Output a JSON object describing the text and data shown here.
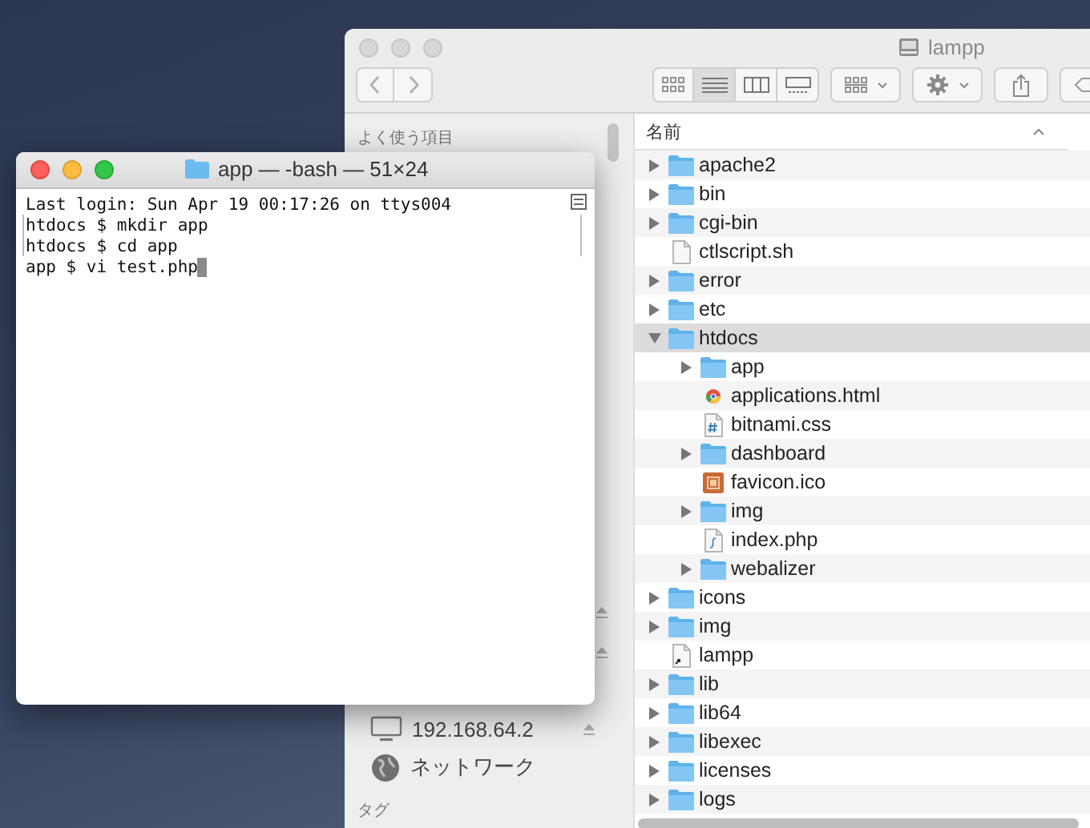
{
  "finder": {
    "title": "lampp",
    "view_buttons": [
      {
        "kind": "icons",
        "selected": false
      },
      {
        "kind": "list",
        "selected": true
      },
      {
        "kind": "columns",
        "selected": false
      },
      {
        "kind": "gallery",
        "selected": false
      }
    ],
    "sidebar": {
      "section": "よく使う項目",
      "items": [
        {
          "kind": "server",
          "label": "192.168.64.2",
          "ejectable": true
        },
        {
          "kind": "network",
          "label": "ネットワーク",
          "ejectable": false
        }
      ],
      "tags_section": "タグ"
    },
    "column_header": "名前",
    "files": [
      {
        "name": "apache2",
        "kind": "folder",
        "expanded": false,
        "selected": false
      },
      {
        "name": "bin",
        "kind": "folder",
        "expanded": false,
        "selected": false
      },
      {
        "name": "cgi-bin",
        "kind": "folder",
        "expanded": false,
        "selected": false
      },
      {
        "name": "ctlscript.sh",
        "kind": "file",
        "selected": false
      },
      {
        "name": "error",
        "kind": "folder",
        "expanded": false,
        "selected": false
      },
      {
        "name": "etc",
        "kind": "folder",
        "expanded": false,
        "selected": false
      },
      {
        "name": "htdocs",
        "kind": "folder",
        "expanded": true,
        "selected": true,
        "children": [
          {
            "name": "app",
            "kind": "folder",
            "expanded": false,
            "selected": false
          },
          {
            "name": "applications.html",
            "kind": "html",
            "selected": false
          },
          {
            "name": "bitnami.css",
            "kind": "css",
            "selected": false
          },
          {
            "name": "dashboard",
            "kind": "folder",
            "expanded": false,
            "selected": false
          },
          {
            "name": "favicon.ico",
            "kind": "image",
            "selected": false
          },
          {
            "name": "img",
            "kind": "folder",
            "expanded": false,
            "selected": false
          },
          {
            "name": "index.php",
            "kind": "php",
            "selected": false
          },
          {
            "name": "webalizer",
            "kind": "folder",
            "expanded": false,
            "selected": false
          }
        ]
      },
      {
        "name": "icons",
        "kind": "folder",
        "expanded": false,
        "selected": false
      },
      {
        "name": "img",
        "kind": "folder",
        "expanded": false,
        "selected": false
      },
      {
        "name": "lampp",
        "kind": "alias",
        "selected": false
      },
      {
        "name": "lib",
        "kind": "folder",
        "expanded": false,
        "selected": false
      },
      {
        "name": "lib64",
        "kind": "folder",
        "expanded": false,
        "selected": false
      },
      {
        "name": "libexec",
        "kind": "folder",
        "expanded": false,
        "selected": false
      },
      {
        "name": "licenses",
        "kind": "folder",
        "expanded": false,
        "selected": false
      },
      {
        "name": "logs",
        "kind": "folder",
        "expanded": false,
        "selected": false
      }
    ]
  },
  "terminal": {
    "title": "app — -bash — 51×24",
    "lines": [
      {
        "text": "Last login: Sun Apr 19 00:17:26 on ttys004",
        "marked": false,
        "cursor": false
      },
      {
        "text": "htdocs $ mkdir app",
        "marked": true,
        "cursor": false
      },
      {
        "text": "htdocs $ cd app",
        "marked": true,
        "cursor": false
      },
      {
        "text": "app $ vi test.php",
        "marked": false,
        "cursor": true
      }
    ]
  }
}
